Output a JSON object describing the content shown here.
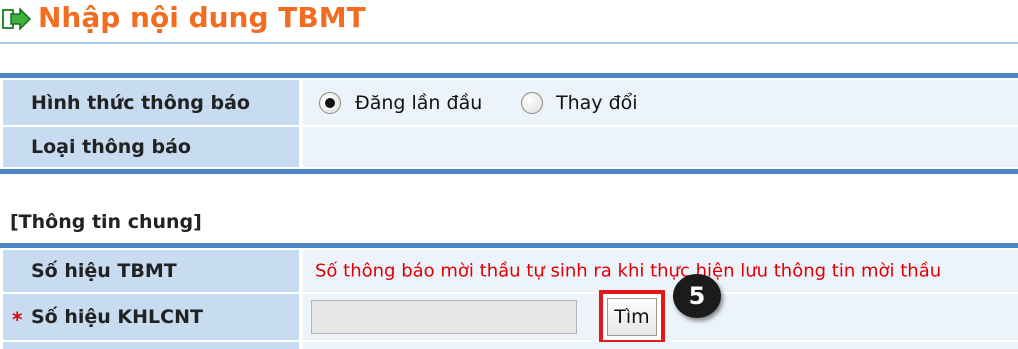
{
  "header": {
    "title": "Nhập nội dung TBMT",
    "icon": "arrow-right-icon",
    "title_color": "#f36d21"
  },
  "notice_form": {
    "notice_type_label": "Hình thức thông báo",
    "notice_type_options": [
      {
        "label": "Đăng lần đầu",
        "selected": true
      },
      {
        "label": "Thay đổi",
        "selected": false
      }
    ],
    "notice_category_label": "Loại thông báo",
    "notice_category_value": ""
  },
  "general_info": {
    "heading": "[Thông tin chung]",
    "tbmt_number_label": "Số hiệu TBMT",
    "tbmt_number_note": "Số thông báo mời thầu tự sinh ra khi thực hiện lưu thông tin mời thầu",
    "khlcnt_required_mark": "*",
    "khlcnt_number_label": "Số hiệu KHLCNT",
    "khlcnt_input_value": "",
    "find_button_label": "Tìm",
    "step_badge": "5"
  },
  "colors": {
    "accent_orange": "#f36d21",
    "label_cell_bg": "#c7dbf1",
    "value_cell_bg": "#ecf3fb",
    "table_border": "#4e86c8",
    "note_red": "#e00000",
    "highlight_red": "#e01818"
  }
}
